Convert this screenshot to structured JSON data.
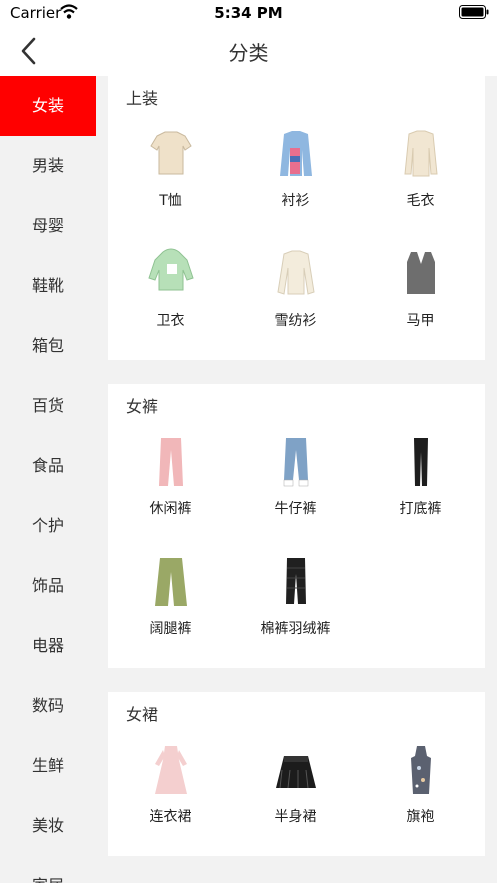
{
  "status": {
    "carrier": "Carrier",
    "time": "5:34 PM"
  },
  "nav": {
    "title": "分类"
  },
  "sidebar": {
    "items": [
      {
        "label": "女装",
        "active": true
      },
      {
        "label": "男装"
      },
      {
        "label": "母婴"
      },
      {
        "label": "鞋靴"
      },
      {
        "label": "箱包"
      },
      {
        "label": "百货"
      },
      {
        "label": "食品"
      },
      {
        "label": "个护"
      },
      {
        "label": "饰品"
      },
      {
        "label": "电器"
      },
      {
        "label": "数码"
      },
      {
        "label": "生鲜"
      },
      {
        "label": "美妆"
      },
      {
        "label": "家居"
      }
    ]
  },
  "sections": [
    {
      "title": "上装",
      "items": [
        {
          "label": "T恤",
          "icon": "tshirt-icon",
          "color": "#efe1c9"
        },
        {
          "label": "衬衫",
          "icon": "shirt-icon",
          "color": "#8fb7e0"
        },
        {
          "label": "毛衣",
          "icon": "sweater-icon",
          "color": "#f1e6d2"
        },
        {
          "label": "卫衣",
          "icon": "hoodie-icon",
          "color": "#b7e0b8"
        },
        {
          "label": "雪纺衫",
          "icon": "blouse-icon",
          "color": "#f3ecdc"
        },
        {
          "label": "马甲",
          "icon": "vest-icon",
          "color": "#6e6e6e"
        }
      ]
    },
    {
      "title": "女裤",
      "items": [
        {
          "label": "休闲裤",
          "icon": "pants-icon",
          "color": "#f1b7b9"
        },
        {
          "label": "牛仔裤",
          "icon": "jeans-icon",
          "color": "#7fa2c6"
        },
        {
          "label": "打底裤",
          "icon": "leggings-icon",
          "color": "#1e1e1e"
        },
        {
          "label": "阔腿裤",
          "icon": "wide-pants-icon",
          "color": "#9aa866"
        },
        {
          "label": "棉裤羽绒裤",
          "icon": "down-pants-icon",
          "color": "#202020"
        }
      ]
    },
    {
      "title": "女裙",
      "items": [
        {
          "label": "连衣裙",
          "icon": "dress-icon",
          "color": "#f4cfcf"
        },
        {
          "label": "半身裙",
          "icon": "skirt-icon",
          "color": "#1c1c1c"
        },
        {
          "label": "旗袍",
          "icon": "qipao-icon",
          "color": "#5b6170"
        }
      ]
    }
  ]
}
